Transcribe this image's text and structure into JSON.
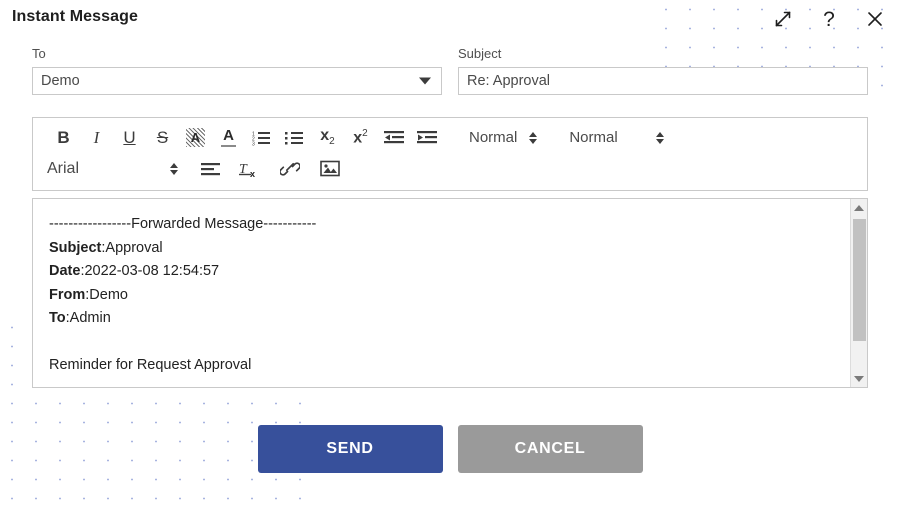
{
  "dialog": {
    "title": "Instant Message"
  },
  "header_actions": [
    {
      "name": "expand-icon",
      "label": "Expand"
    },
    {
      "name": "help-icon",
      "label": "?"
    },
    {
      "name": "close-icon",
      "label": "×"
    }
  ],
  "fields": {
    "to": {
      "label": "To",
      "value": "Demo",
      "dropdown_icon": "chevron-down-icon"
    },
    "subject": {
      "label": "Subject",
      "value": "Re: Approval"
    }
  },
  "editor": {
    "toolbar": {
      "row1": [
        {
          "name": "bold-icon",
          "glyph": "B"
        },
        {
          "name": "italic-icon",
          "glyph": "I"
        },
        {
          "name": "underline-icon",
          "glyph": "U"
        },
        {
          "name": "strikethrough-icon",
          "glyph": "S"
        },
        {
          "name": "highlight-color-icon",
          "glyph": "A"
        },
        {
          "name": "font-color-icon",
          "glyph": "A"
        },
        {
          "name": "ordered-list-icon",
          "glyph": ""
        },
        {
          "name": "unordered-list-icon",
          "glyph": ""
        },
        {
          "name": "subscript-icon",
          "glyph": "x"
        },
        {
          "name": "superscript-icon",
          "glyph": "x"
        },
        {
          "name": "outdent-icon",
          "glyph": ""
        },
        {
          "name": "indent-icon",
          "glyph": ""
        }
      ],
      "format_dropdown": {
        "label": "Normal",
        "spinner_icon": "spinner-icon"
      },
      "size_dropdown": {
        "label": "Normal",
        "spinner_icon": "spinner-icon"
      },
      "font_dropdown": {
        "label": "Arial",
        "spinner_icon": "spinner-icon"
      },
      "row2": [
        {
          "name": "align-left-icon",
          "glyph": ""
        },
        {
          "name": "clear-format-icon",
          "glyph": "Tx"
        },
        {
          "name": "link-icon",
          "glyph": ""
        },
        {
          "name": "image-icon",
          "glyph": ""
        }
      ]
    },
    "body": {
      "forwarded_divider": "-----------------Forwarded Message-----------",
      "meta": [
        {
          "label": "Subject",
          "value": ":Approval"
        },
        {
          "label": "Date",
          "value": ":2022-03-08 12:54:57"
        },
        {
          "label": "From",
          "value": ":Demo"
        },
        {
          "label": "To",
          "value": ":Admin"
        }
      ],
      "message_line": "Reminder for Request Approval"
    },
    "scrollbar": {
      "up_icon": "scroll-up-arrow-icon",
      "down_icon": "scroll-down-arrow-icon"
    }
  },
  "footer": {
    "send_label": "SEND",
    "cancel_label": "CANCEL"
  },
  "colors": {
    "send_button": "#37509b",
    "cancel_button": "#9a9a9a",
    "dot_pattern": "#a8b4e0",
    "border": "#c9c9c9"
  }
}
